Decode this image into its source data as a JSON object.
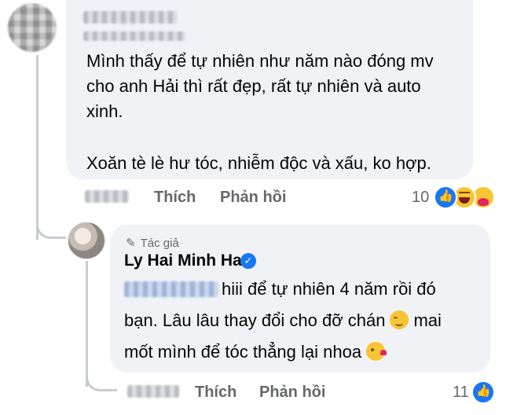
{
  "comments": [
    {
      "text_lines": [
        "Mình thấy để tự nhiên như năm nào đóng mv",
        "cho anh Hải thì rất đẹp, rất tự nhiên và auto",
        "xinh."
      ],
      "text_para2": "Xoăn tè lè hư tóc, nhiễm độc và xấu, ko hợp.",
      "actions": {
        "like": "Thích",
        "reply": "Phản hồi"
      },
      "reaction_count": "10"
    }
  ],
  "reply": {
    "author_badge": "Tác giả",
    "author_name": "Ly Hai Minh Ha",
    "line1": "hiii để tự nhiên 4 năm rồi đó",
    "line2_a": "bạn. Lâu lâu thay đổi cho đỡ chán",
    "line2_b": "mai",
    "line3": "mốt mình để tóc thẳng lại nhoa",
    "actions": {
      "like": "Thích",
      "reply": "Phản hồi"
    },
    "reaction_count": "11"
  },
  "icons": {
    "reactions_comment": [
      "like-icon",
      "haha-icon",
      "care-icon"
    ],
    "reactions_reply": [
      "like-icon"
    ],
    "emoji_inline": [
      "relieved-face-icon",
      "kissing-face-icon"
    ]
  }
}
